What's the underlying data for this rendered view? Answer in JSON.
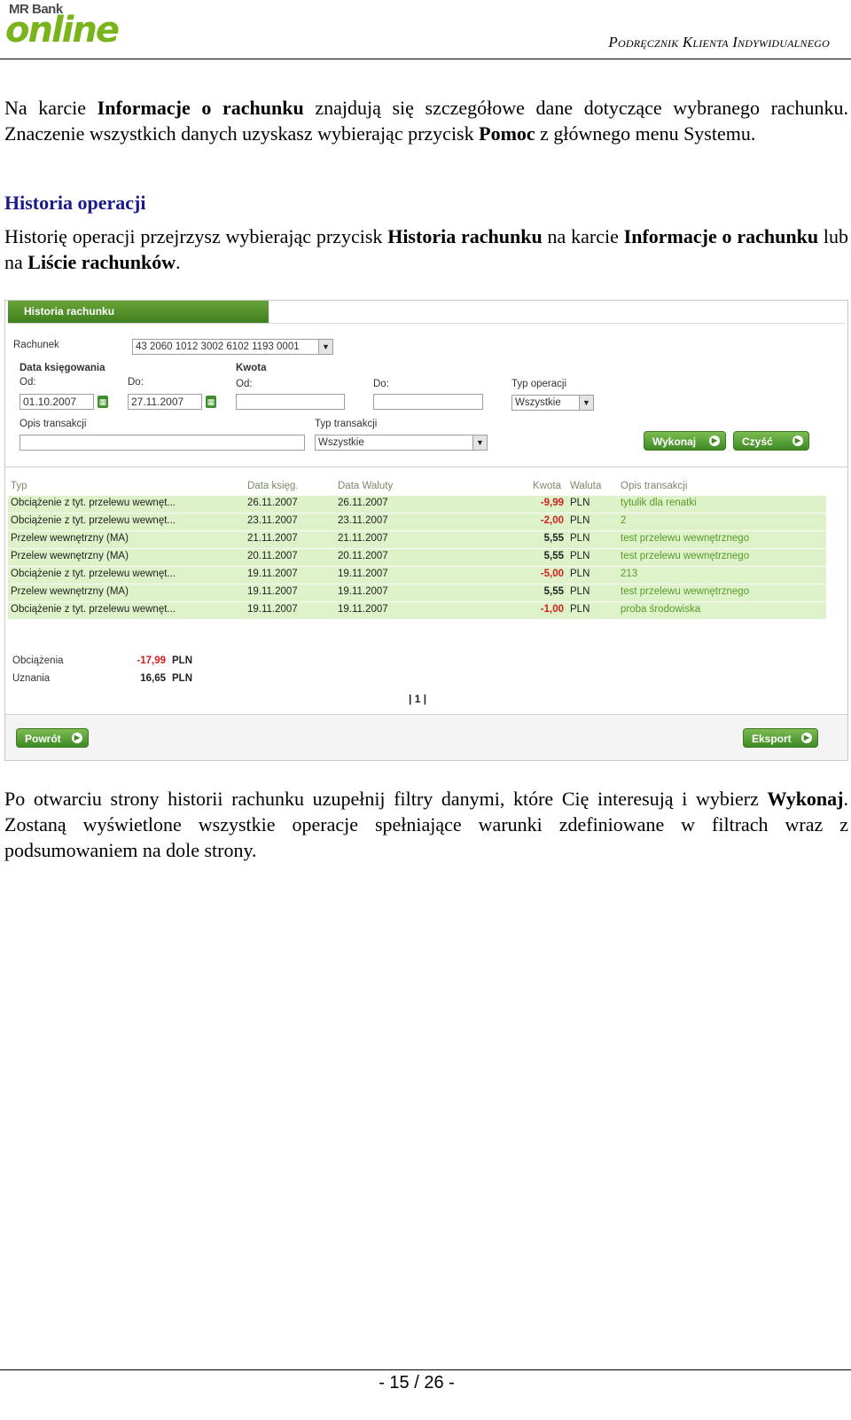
{
  "header": {
    "logo_bank": "MR Bank",
    "logo_online": "online",
    "doc_title": "Podręcznik Klienta Indywidualnego"
  },
  "para1": {
    "t1": "Na karcie ",
    "b1": "Informacje o rachunku",
    "t2": " znajdują się szczegółowe dane dotyczące wybranego rachunku. Znaczenie wszystkich danych uzyskasz wybierając przycisk ",
    "b2": "Pomoc",
    "t3": " z głównego menu Systemu."
  },
  "section_heading": "Historia operacji",
  "para2": {
    "t1": "Historię operacji przejrzysz wybierając przycisk ",
    "b1": "Historia rachunku",
    "t2": " na karcie ",
    "b2": "Informacje o rachunku",
    "t3": " lub na ",
    "b3": "Liście rachunków",
    "t4": "."
  },
  "screenshot": {
    "tab_title": "Historia rachunku",
    "account_label": "Rachunek",
    "account_value": "43 2060 1012 3002 6102 1193 0001",
    "booking_date_label": "Data księgowania",
    "from_label": "Od:",
    "to_label": "Do:",
    "date_from": "01.10.2007",
    "date_to": "27.11.2007",
    "amount_label": "Kwota",
    "amount_from_label": "Od:",
    "amount_to_label": "Do:",
    "op_type_label": "Typ operacji",
    "op_type_value": "Wszystkie",
    "desc_label": "Opis transakcji",
    "tx_type_label": "Typ transakcji",
    "tx_type_value": "Wszystkie",
    "execute_btn": "Wykonaj",
    "clear_btn": "Czyść",
    "columns": {
      "type": "Typ",
      "booking": "Data księg.",
      "value_date": "Data Waluty",
      "amount": "Kwota",
      "currency": "Waluta",
      "desc": "Opis transakcji"
    },
    "rows": [
      {
        "type": "Obciążenie z tyt. przelewu wewnęt...",
        "booking": "26.11.2007",
        "value_date": "26.11.2007",
        "amount": "-9,99",
        "currency": "PLN",
        "desc": "tytulik dla renatki"
      },
      {
        "type": "Obciążenie z tyt. przelewu wewnęt...",
        "booking": "23.11.2007",
        "value_date": "23.11.2007",
        "amount": "-2,00",
        "currency": "PLN",
        "desc": "2"
      },
      {
        "type": "Przelew wewnętrzny (MA)",
        "booking": "21.11.2007",
        "value_date": "21.11.2007",
        "amount": "5,55",
        "currency": "PLN",
        "desc": "test przelewu wewnętrznego"
      },
      {
        "type": "Przelew wewnętrzny (MA)",
        "booking": "20.11.2007",
        "value_date": "20.11.2007",
        "amount": "5,55",
        "currency": "PLN",
        "desc": "test przelewu wewnętrznego"
      },
      {
        "type": "Obciążenie z tyt. przelewu wewnęt...",
        "booking": "19.11.2007",
        "value_date": "19.11.2007",
        "amount": "-5,00",
        "currency": "PLN",
        "desc": "213"
      },
      {
        "type": "Przelew wewnętrzny (MA)",
        "booking": "19.11.2007",
        "value_date": "19.11.2007",
        "amount": "5,55",
        "currency": "PLN",
        "desc": "test przelewu wewnętrznego"
      },
      {
        "type": "Obciążenie z tyt. przelewu wewnęt...",
        "booking": "19.11.2007",
        "value_date": "19.11.2007",
        "amount": "-1,00",
        "currency": "PLN",
        "desc": "proba środowiska"
      }
    ],
    "debits_label": "Obciążenia",
    "debits_value": "-17,99",
    "credits_label": "Uznania",
    "credits_value": "16,65",
    "sum_currency": "PLN",
    "pager": "| 1 |",
    "back_btn": "Powrót",
    "export_btn": "Eksport"
  },
  "para3": {
    "t1": "Po otwarciu strony historii rachunku uzupełnij filtry danymi, które Cię interesują i wybierz ",
    "b1": "Wykonaj",
    "t2": ". Zostaną wyświetlone wszystkie operacje spełniające warunki zdefiniowane w filtrach wraz z podsumowaniem na dole strony."
  },
  "page_number": "- 15 / 26 -",
  "colors": {
    "accent_green": "#3d8a24",
    "heading_blue": "#1a1a8c",
    "negative_red": "#d21f1f",
    "row_green": "#ddf2c8"
  }
}
